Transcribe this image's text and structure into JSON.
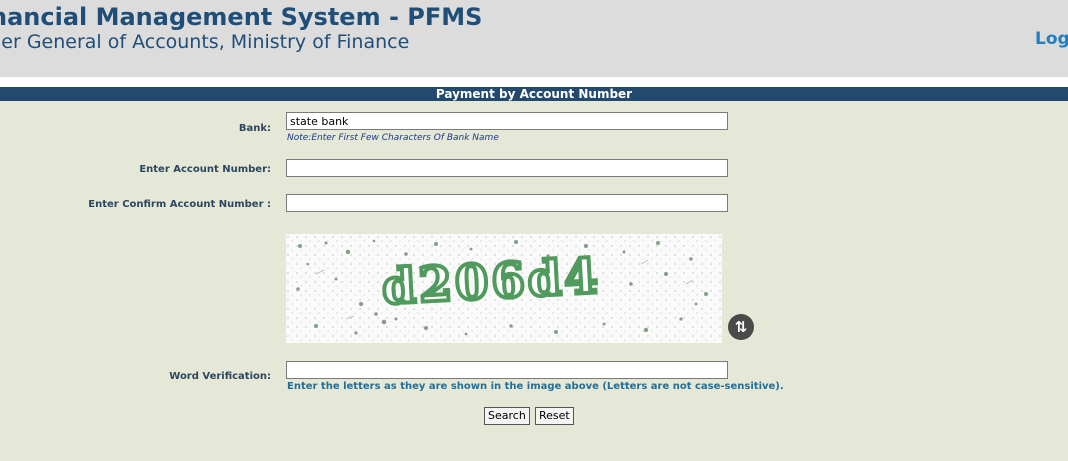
{
  "header": {
    "title_line1": "nancial Management System - PFMS",
    "title_line2": "ler General of Accounts, Ministry of Finance",
    "login_link": "Log"
  },
  "form": {
    "section_title": "Payment by Account Number",
    "bank_label": "Bank:",
    "bank_value": "state bank",
    "bank_note": "Note:Enter First Few Characters Of Bank Name",
    "account_label": "Enter Account Number:",
    "account_value": "",
    "confirm_label": "Enter Confirm Account Number :",
    "confirm_value": "",
    "captcha_text": "d206d4",
    "refresh_icon": "refresh-icon",
    "word_label": "Word Verification:",
    "word_value": "",
    "word_hint": "Enter the letters as they are shown in the image above (Letters are not case-sensitive).",
    "search_label": "Search",
    "reset_label": "Reset"
  },
  "colors": {
    "header_bg": "#dcdcdc",
    "title_color": "#1f4e79",
    "section_bar": "#234a6e",
    "page_bg": "#e5e8d6",
    "captcha_text_color": "#4f9a5c"
  }
}
